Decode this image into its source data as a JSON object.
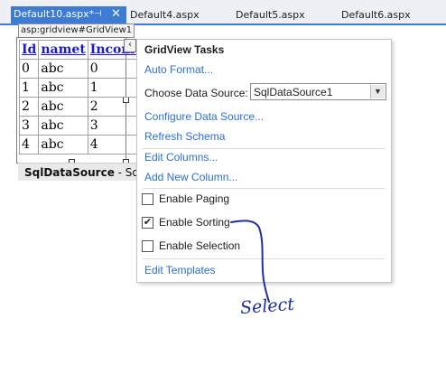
{
  "tabs": [
    {
      "label": "Default10.aspx*",
      "active": true
    },
    {
      "label": "Default4.aspx",
      "active": false
    },
    {
      "label": "Default5.aspx",
      "active": false
    },
    {
      "label": "Default6.aspx",
      "active": false
    }
  ],
  "tab_icons": {
    "pin": "pin-icon",
    "close": "close-icon"
  },
  "designer": {
    "gridview_label": "asp:gridview#GridView1",
    "grid": {
      "headers": [
        "Id",
        "namet",
        "Income"
      ],
      "rows": [
        [
          "0",
          "abc",
          "0"
        ],
        [
          "1",
          "abc",
          "1"
        ],
        [
          "2",
          "abc",
          "2"
        ],
        [
          "3",
          "abc",
          "3"
        ],
        [
          "4",
          "abc",
          "4"
        ]
      ]
    },
    "smart_tag_glyph": "‹",
    "sqldatasource_name": "SqlDataSource",
    "sqldatasource_rest": " - SqlDa"
  },
  "tasks": {
    "title": "GridView Tasks",
    "auto_format": "Auto Format...",
    "choose_ds_label": "Choose Data Source:",
    "choose_ds_value": "SqlDataSource1",
    "configure_ds": "Configure Data Source...",
    "refresh_schema": "Refresh Schema",
    "edit_columns": "Edit Columns...",
    "add_column": "Add New Column...",
    "enable_paging": {
      "label": "Enable Paging",
      "checked": false
    },
    "enable_sorting": {
      "label": "Enable Sorting",
      "checked": true
    },
    "enable_selection": {
      "label": "Enable Selection",
      "checked": false
    },
    "edit_templates": "Edit Templates",
    "check_glyph": "✔",
    "dropdown_glyph": "▼"
  },
  "annotation": {
    "text": "Select",
    "color": "#1f2f9e"
  },
  "colors": {
    "accent": "#3d7bd4",
    "link": "#2a6fd6"
  }
}
